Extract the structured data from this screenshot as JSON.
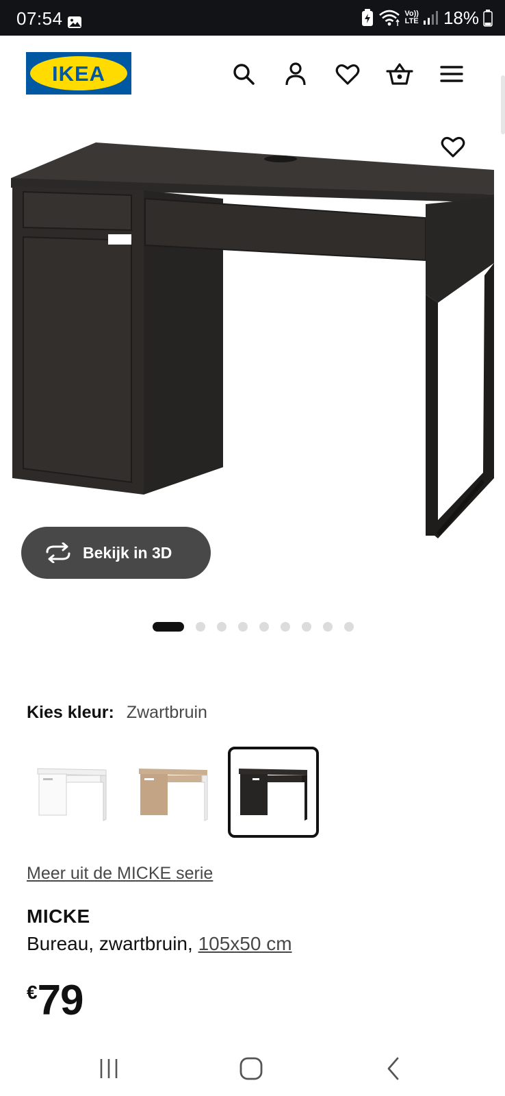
{
  "status_bar": {
    "time": "07:54",
    "battery_percent": "18%",
    "net_label_top": "Vo))",
    "net_label_bottom": "LTE"
  },
  "header": {
    "logo_text": "IKEA",
    "brand_colors": {
      "blue": "#0058A3",
      "yellow": "#FFDB00"
    },
    "icons": [
      "search-icon",
      "account-icon",
      "wishlist-icon",
      "cart-icon",
      "menu-icon"
    ]
  },
  "product_image": {
    "view3d_label": "Bekijk in 3D",
    "carousel": {
      "total": 10,
      "active_index": 0
    }
  },
  "color_choice": {
    "label": "Kies kleur:",
    "selected_value": "Zwartbruin",
    "options": [
      {
        "name": "wit",
        "color": "#f4f4f4",
        "selected": false
      },
      {
        "name": "wit gebeitst eiken",
        "color": "#c8ad8f",
        "selected": false
      },
      {
        "name": "zwartbruin",
        "color": "#2e2b28",
        "selected": true
      }
    ]
  },
  "series_link": "Meer uit de MICKE serie",
  "product": {
    "name": "MICKE",
    "description_prefix": "Bureau, zwartbruin, ",
    "size": "105x50 cm",
    "price_currency": "€",
    "price_amount": "79"
  },
  "navbar": {
    "recent_icon": "recent-apps-icon",
    "home_icon": "home-icon",
    "back_icon": "back-icon"
  }
}
